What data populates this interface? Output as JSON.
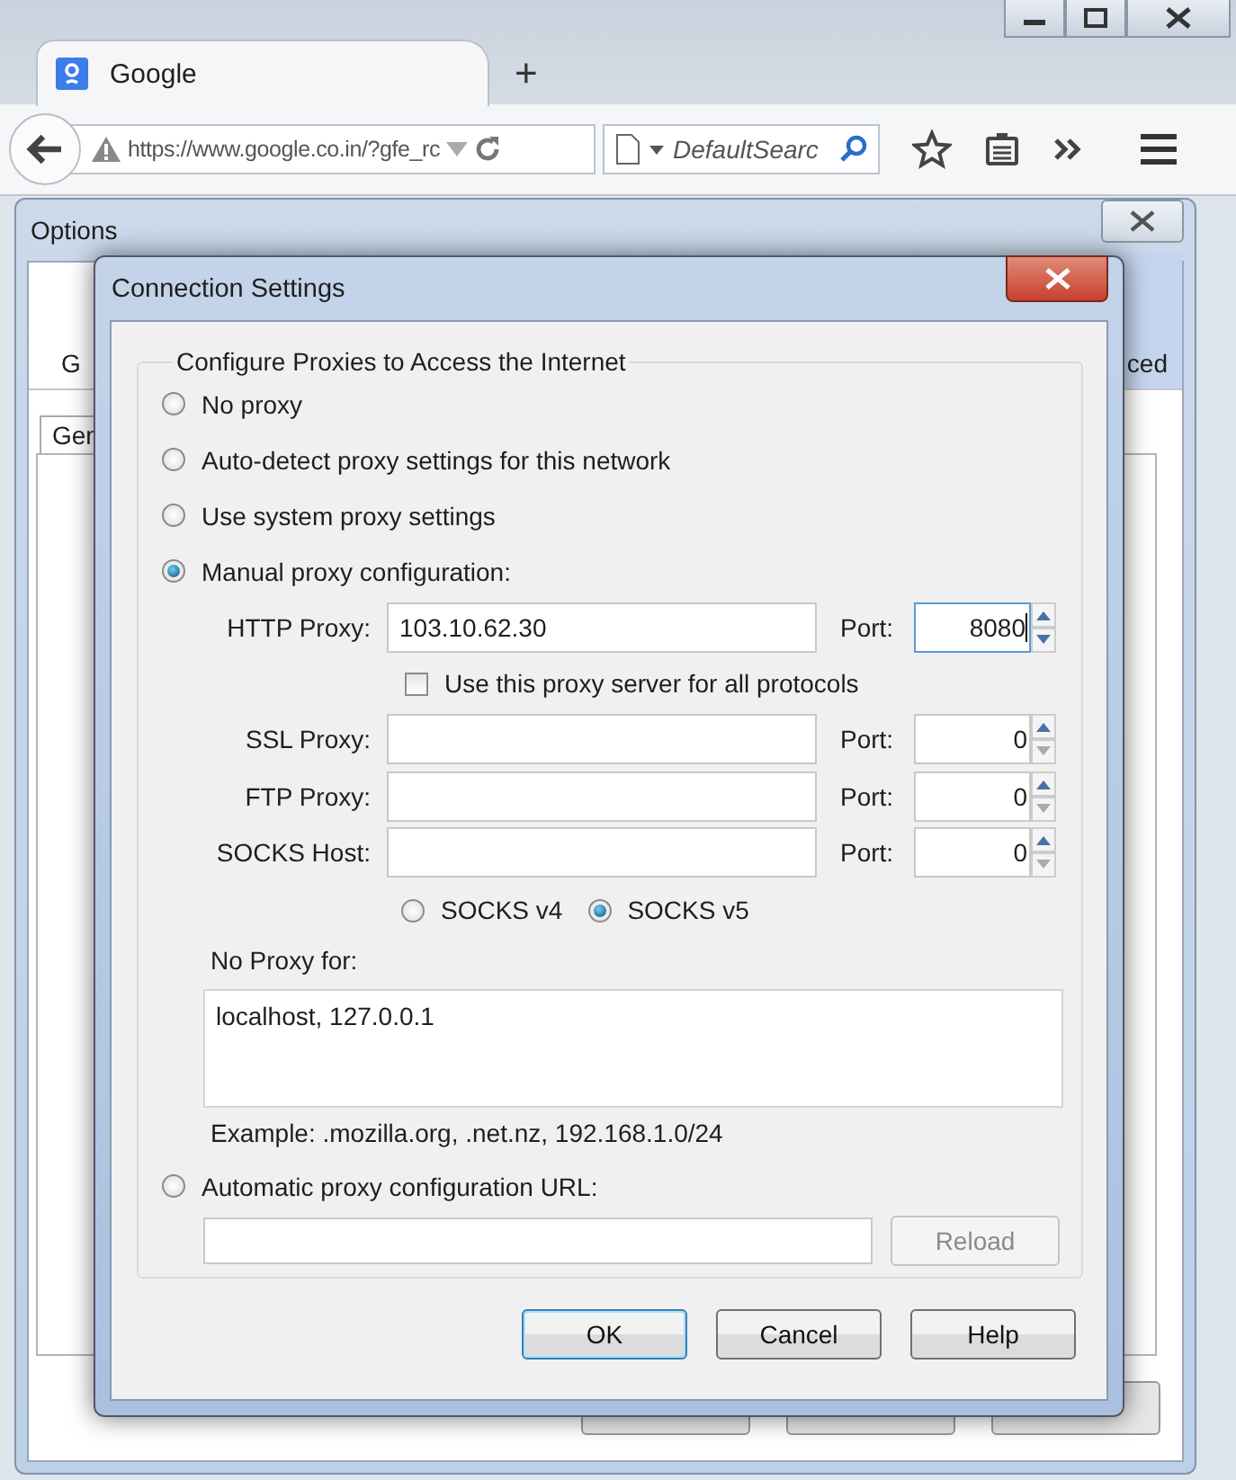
{
  "browser": {
    "tab": {
      "title": "Google",
      "selected": true
    },
    "new_tab": "+",
    "url": "https://www.google.co.in/?gfe_rc",
    "search_placeholder": "DefaultSearc"
  },
  "options_window": {
    "title": "Options",
    "tabs": [
      {
        "label": "G",
        "selected": false
      },
      {
        "label": "ced",
        "selected": true
      }
    ],
    "panel_tab": "Gen"
  },
  "dialog": {
    "title": "Connection Settings",
    "group_title": "Configure Proxies to Access the Internet",
    "modes": [
      {
        "label": "No proxy",
        "selected": false
      },
      {
        "label": "Auto-detect proxy settings for this network",
        "selected": false
      },
      {
        "label": "Use system proxy settings",
        "selected": false
      },
      {
        "label": "Manual proxy configuration:",
        "selected": true
      }
    ],
    "proxies": [
      {
        "label": "HTTP Proxy:",
        "value": "103.10.62.30",
        "port_label": "Port:",
        "port": "8080",
        "port_focused": true
      },
      {
        "label": "SSL Proxy:",
        "port_label": "Port:",
        "port": "0",
        "port_focused": false
      },
      {
        "label": "FTP Proxy:",
        "port_label": "Port:",
        "port": "0",
        "port_focused": false
      },
      {
        "label": "SOCKS Host:",
        "port_label": "Port:",
        "port": "0",
        "port_focused": false
      }
    ],
    "share_all": {
      "label": "Use this proxy server for all protocols",
      "checked": false
    },
    "socks_versions": [
      {
        "label": "SOCKS v4",
        "selected": false
      },
      {
        "label": "SOCKS v5",
        "selected": true
      }
    ],
    "no_proxy_label": "No Proxy for:",
    "no_proxy_value": "localhost, 127.0.0.1",
    "example": "Example: .mozilla.org, .net.nz, 192.168.1.0/24",
    "auto_mode": {
      "label": "Automatic proxy configuration URL:",
      "selected": false
    },
    "reload": {
      "label": "Reload",
      "disabled": true
    },
    "buttons": [
      {
        "label": "OK",
        "default": true
      },
      {
        "label": "Cancel",
        "default": false
      },
      {
        "label": "Help",
        "default": false
      }
    ]
  }
}
